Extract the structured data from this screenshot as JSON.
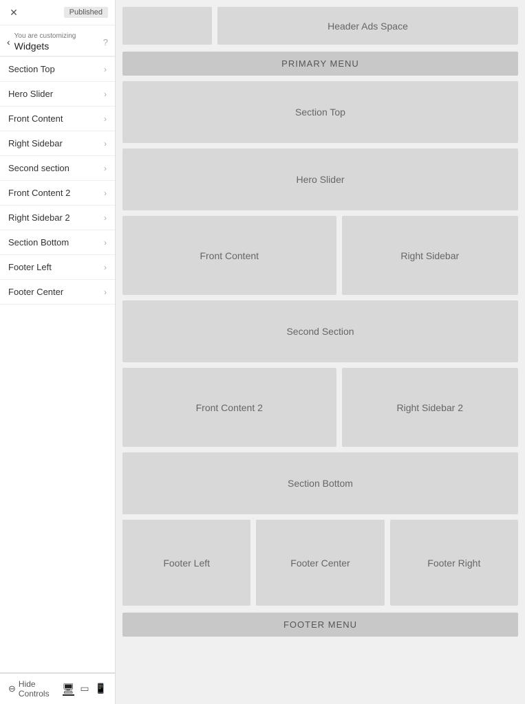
{
  "sidebar": {
    "topbar": {
      "close_icon": "✕",
      "published_label": "Published"
    },
    "nav": {
      "back_icon": "‹",
      "customizing_label": "You are customizing",
      "title": "Widgets",
      "help_icon": "?"
    },
    "menu_items": [
      {
        "label": "Section Top"
      },
      {
        "label": "Hero Slider"
      },
      {
        "label": "Front Content"
      },
      {
        "label": "Right Sidebar"
      },
      {
        "label": "Second section"
      },
      {
        "label": "Front Content 2"
      },
      {
        "label": "Right Sidebar 2"
      },
      {
        "label": "Section Bottom"
      },
      {
        "label": "Footer Left"
      },
      {
        "label": "Footer Center"
      }
    ],
    "footer": {
      "hide_controls_label": "Hide Controls",
      "hide_icon": "⊖"
    }
  },
  "main": {
    "header_logo_area": "",
    "header_ads_label": "Header Ads Space",
    "primary_menu_label": "PRIMARY MENU",
    "widgets": {
      "section_top": "Section Top",
      "hero_slider": "Hero Slider",
      "front_content": "Front Content",
      "right_sidebar": "Right Sidebar",
      "second_section": "Second Section",
      "front_content_2": "Front Content 2",
      "right_sidebar_2": "Right Sidebar 2",
      "section_bottom": "Section Bottom",
      "footer_left": "Footer Left",
      "footer_center": "Footer Center",
      "footer_right": "Footer Right"
    },
    "footer_menu_label": "FOOTER MENU"
  }
}
